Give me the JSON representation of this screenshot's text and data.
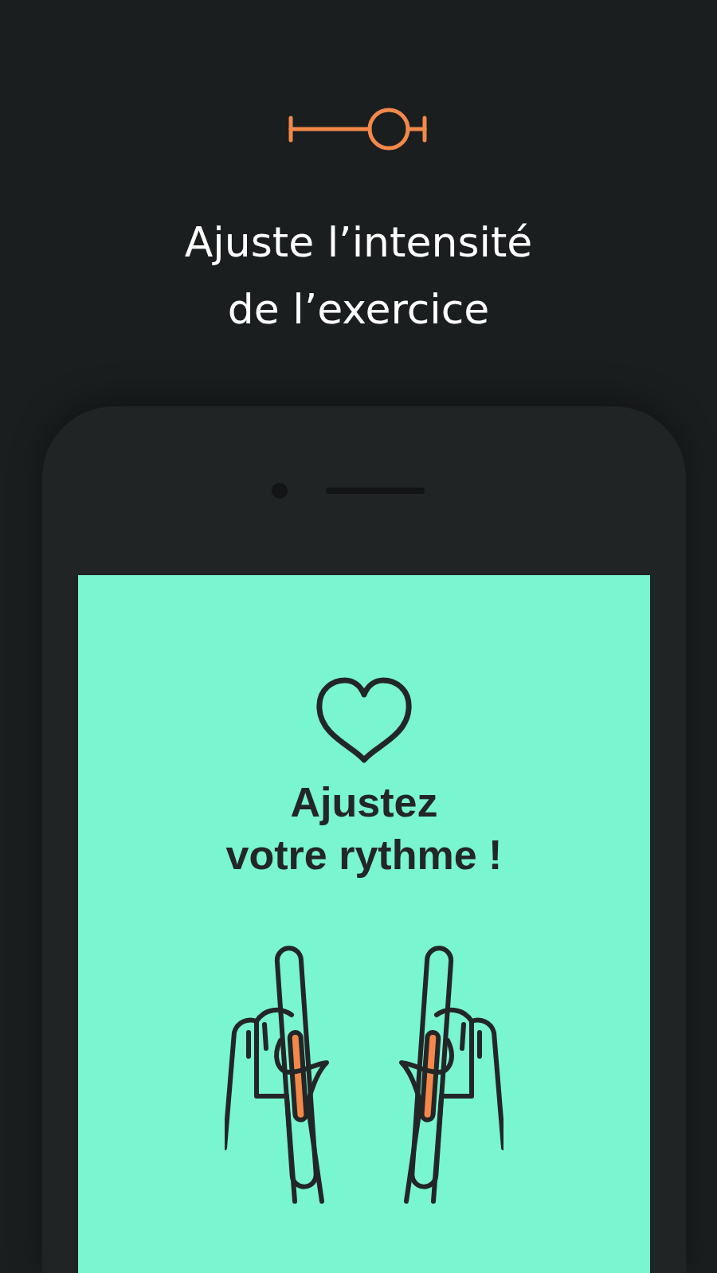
{
  "headline": "Ajuste l’intensité\nde l’exercice",
  "phone": {
    "screen": {
      "title": "Ajustez\nvotre rythme !"
    }
  }
}
